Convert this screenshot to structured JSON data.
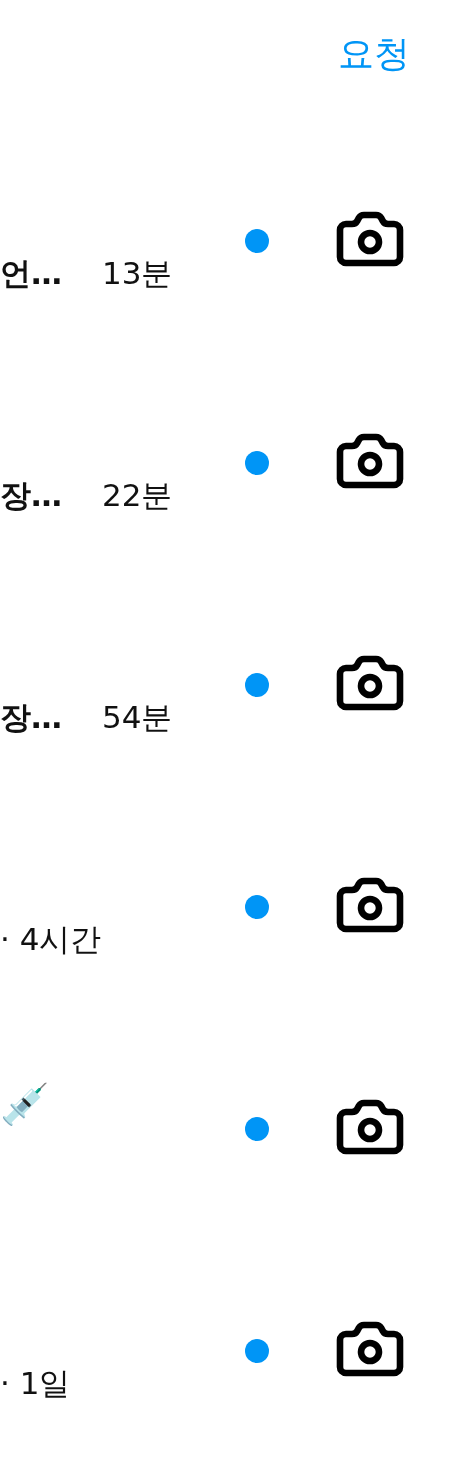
{
  "header": {
    "requests_link": "요청"
  },
  "threads": [
    {
      "preview": "언…",
      "time": "13분",
      "unread": true
    },
    {
      "preview": "장…",
      "time": "22분",
      "unread": true
    },
    {
      "preview": "장…",
      "time": "54분",
      "unread": true
    },
    {
      "time": "· 4시간",
      "unread": true
    },
    {
      "name": "💉",
      "unread": true
    },
    {
      "time": "· 1일",
      "unread": true
    }
  ]
}
